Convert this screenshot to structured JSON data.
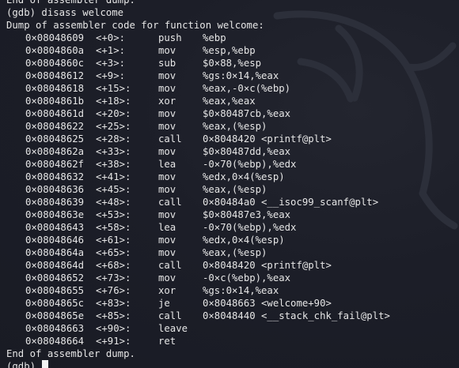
{
  "terminal": {
    "partial_header": "End of assembler dump.",
    "command_line": "(gdb) disass welcome",
    "dump_header": "Dump of assembler code for function welcome:",
    "instructions": [
      {
        "address": "0×08048609",
        "offset": "<+0>:",
        "mnemonic": "push",
        "operands": "%ebp"
      },
      {
        "address": "0×0804860a",
        "offset": "<+1>:",
        "mnemonic": "mov",
        "operands": "%esp,%ebp"
      },
      {
        "address": "0×0804860c",
        "offset": "<+3>:",
        "mnemonic": "sub",
        "operands": "$0×88,%esp"
      },
      {
        "address": "0×08048612",
        "offset": "<+9>:",
        "mnemonic": "mov",
        "operands": "%gs:0×14,%eax"
      },
      {
        "address": "0×08048618",
        "offset": "<+15>:",
        "mnemonic": "mov",
        "operands": "%eax,-0×c(%ebp)"
      },
      {
        "address": "0×0804861b",
        "offset": "<+18>:",
        "mnemonic": "xor",
        "operands": "%eax,%eax"
      },
      {
        "address": "0×0804861d",
        "offset": "<+20>:",
        "mnemonic": "mov",
        "operands": "$0×80487cb,%eax"
      },
      {
        "address": "0×08048622",
        "offset": "<+25>:",
        "mnemonic": "mov",
        "operands": "%eax,(%esp)"
      },
      {
        "address": "0×08048625",
        "offset": "<+28>:",
        "mnemonic": "call",
        "operands": "0×8048420 <printf@plt>"
      },
      {
        "address": "0×0804862a",
        "offset": "<+33>:",
        "mnemonic": "mov",
        "operands": "$0×80487dd,%eax"
      },
      {
        "address": "0×0804862f",
        "offset": "<+38>:",
        "mnemonic": "lea",
        "operands": "-0×70(%ebp),%edx"
      },
      {
        "address": "0×08048632",
        "offset": "<+41>:",
        "mnemonic": "mov",
        "operands": "%edx,0×4(%esp)"
      },
      {
        "address": "0×08048636",
        "offset": "<+45>:",
        "mnemonic": "mov",
        "operands": "%eax,(%esp)"
      },
      {
        "address": "0×08048639",
        "offset": "<+48>:",
        "mnemonic": "call",
        "operands": "0×80484a0 <__isoc99_scanf@plt>"
      },
      {
        "address": "0×0804863e",
        "offset": "<+53>:",
        "mnemonic": "mov",
        "operands": "$0×80487e3,%eax"
      },
      {
        "address": "0×08048643",
        "offset": "<+58>:",
        "mnemonic": "lea",
        "operands": "-0×70(%ebp),%edx"
      },
      {
        "address": "0×08048646",
        "offset": "<+61>:",
        "mnemonic": "mov",
        "operands": "%edx,0×4(%esp)"
      },
      {
        "address": "0×0804864a",
        "offset": "<+65>:",
        "mnemonic": "mov",
        "operands": "%eax,(%esp)"
      },
      {
        "address": "0×0804864d",
        "offset": "<+68>:",
        "mnemonic": "call",
        "operands": "0×8048420 <printf@plt>"
      },
      {
        "address": "0×08048652",
        "offset": "<+73>:",
        "mnemonic": "mov",
        "operands": "-0×c(%ebp),%eax"
      },
      {
        "address": "0×08048655",
        "offset": "<+76>:",
        "mnemonic": "xor",
        "operands": "%gs:0×14,%eax"
      },
      {
        "address": "0×0804865c",
        "offset": "<+83>:",
        "mnemonic": "je",
        "operands": "0×8048663 <welcome+90>"
      },
      {
        "address": "0×0804865e",
        "offset": "<+85>:",
        "mnemonic": "call",
        "operands": "0×8048440 <__stack_chk_fail@plt>"
      },
      {
        "address": "0×08048663",
        "offset": "<+90>:",
        "mnemonic": "leave",
        "operands": ""
      },
      {
        "address": "0×08048664",
        "offset": "<+91>:",
        "mnemonic": "ret",
        "operands": ""
      }
    ],
    "footer": "End of assembler dump.",
    "prompt": "(gdb) ",
    "watermark_icon": "kali-dragon-icon",
    "colors": {
      "background": "#1b1d27",
      "text": "#e6e6e6",
      "cursor": "#f2f2f2"
    }
  }
}
